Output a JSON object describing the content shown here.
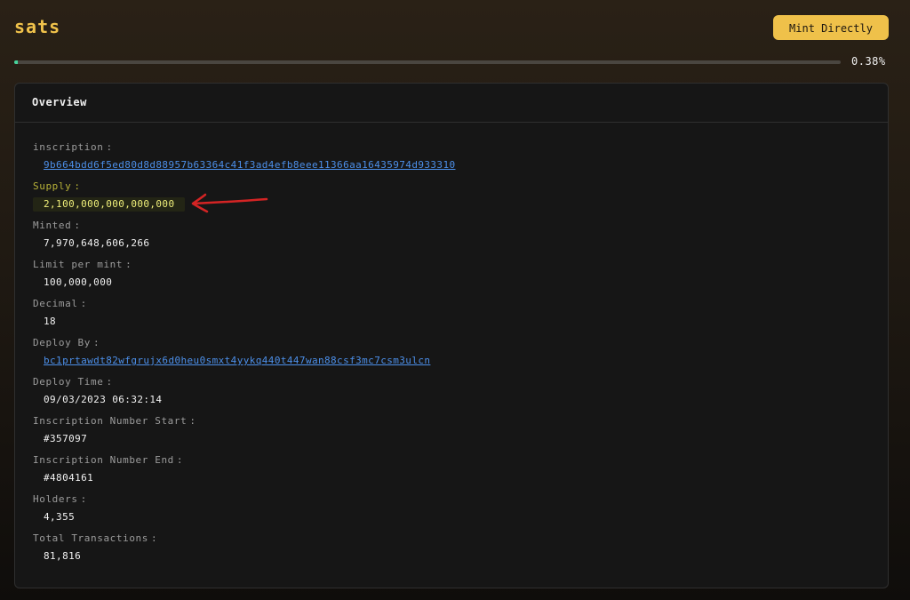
{
  "header": {
    "title": "sats",
    "mint_button_label": "Mint Directly"
  },
  "progress": {
    "percent": 0.38,
    "label": "0.38%",
    "fill_color": "#46d39b"
  },
  "overview": {
    "title": "Overview",
    "fields": [
      {
        "label": "inscription",
        "value": "9b664bdd6f5ed80d8d88957b63364c41f3ad4efb8eee11366aa16435974d933310",
        "link": true
      },
      {
        "label": "Supply",
        "value": "2,100,000,000,000,000",
        "highlighted": true
      },
      {
        "label": "Minted",
        "value": "7,970,648,606,266"
      },
      {
        "label": "Limit per mint",
        "value": "100,000,000"
      },
      {
        "label": "Decimal",
        "value": "18"
      },
      {
        "label": "Deploy By",
        "value": "bc1prtawdt82wfgrujx6d0heu0smxt4yykq440t447wan88csf3mc7csm3ulcn",
        "link": true
      },
      {
        "label": "Deploy Time",
        "value": "09/03/2023 06:32:14"
      },
      {
        "label": "Inscription Number Start",
        "value": "#357097"
      },
      {
        "label": "Inscription Number End",
        "value": "#4804161"
      },
      {
        "label": "Holders",
        "value": "4,355"
      },
      {
        "label": "Total Transactions",
        "value": "81,816"
      }
    ]
  },
  "colors": {
    "accent": "#efc14a",
    "link": "#4c8fe9",
    "annotation": "#d42424"
  }
}
